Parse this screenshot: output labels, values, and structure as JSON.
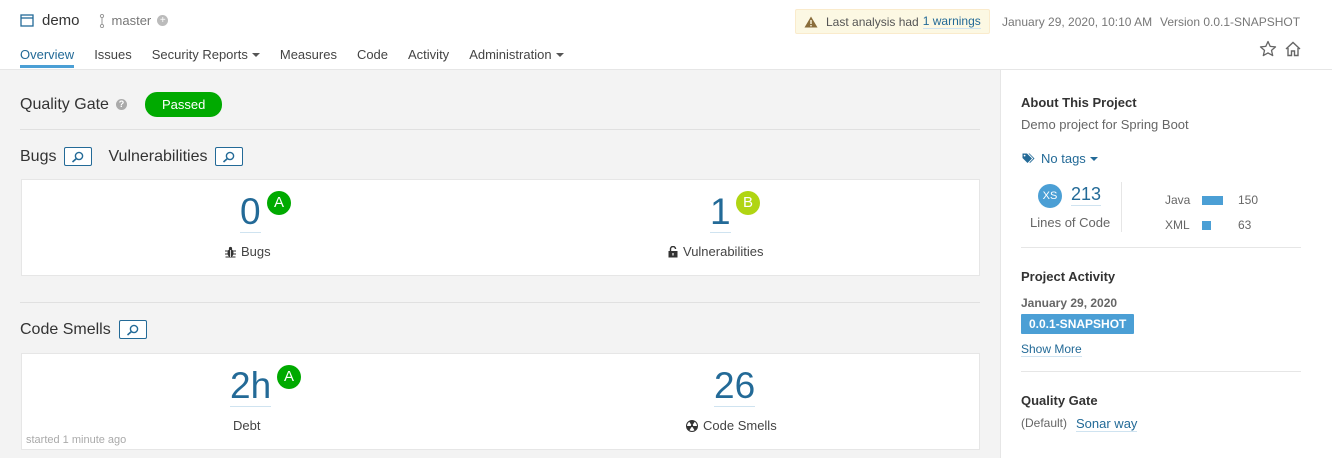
{
  "project": {
    "name": "demo",
    "branch": "master"
  },
  "warning": {
    "text": "Last analysis had",
    "link": "1 warnings"
  },
  "analysis_date": "January 29, 2020, 10:10 AM",
  "version": "Version 0.0.1-SNAPSHOT",
  "nav": {
    "overview": "Overview",
    "issues": "Issues",
    "security_reports": "Security Reports",
    "measures": "Measures",
    "code": "Code",
    "activity": "Activity",
    "administration": "Administration"
  },
  "quality_gate": {
    "title": "Quality Gate",
    "status": "Passed",
    "status_color": "#00aa00"
  },
  "bugs_vulns": {
    "bugs_heading": "Bugs",
    "vulns_heading": "Vulnerabilities",
    "bugs_value": "0",
    "bugs_rating": "A",
    "bugs_label": "Bugs",
    "vulns_value": "1",
    "vulns_rating": "B",
    "vulns_label": "Vulnerabilities"
  },
  "code_smells": {
    "heading": "Code Smells",
    "debt_value": "2h",
    "debt_rating": "A",
    "debt_label": "Debt",
    "smells_value": "26",
    "smells_label": "Code Smells"
  },
  "started": "started 1 minute ago",
  "sidebar": {
    "about_title": "About This Project",
    "description": "Demo project for Spring Boot",
    "tags": "No tags",
    "size_badge": "XS",
    "loc_value": "213",
    "loc_label": "Lines of Code",
    "languages": [
      {
        "name": "Java",
        "value": "150",
        "fraction": 1.0
      },
      {
        "name": "XML",
        "value": "63",
        "fraction": 0.42
      }
    ],
    "activity_title": "Project Activity",
    "activity_date": "January 29, 2020",
    "activity_version": "0.0.1-SNAPSHOT",
    "show_more": "Show More",
    "qg_title": "Quality Gate",
    "qg_default": "(Default)",
    "qg_name": "Sonar way"
  },
  "colors": {
    "accent": "#236a97",
    "rating_a": "#00aa00",
    "rating_b": "#b0d513"
  }
}
